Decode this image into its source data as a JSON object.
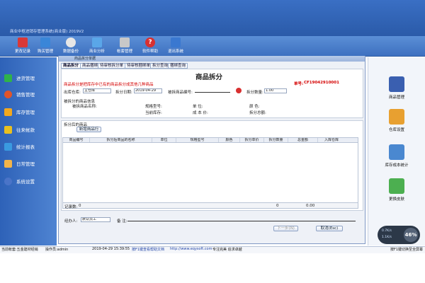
{
  "titlebar": {
    "title": "商业中枢进销存管理系统(商业版) 2019V2"
  },
  "toolbar": [
    {
      "label": "更改记录",
      "color": "#ffffff"
    },
    {
      "label": "购买管理",
      "color": "#ffffff"
    },
    {
      "label": "数据备份",
      "color": "#ffffff"
    },
    {
      "label": "商业分析",
      "color": "#ffffff"
    },
    {
      "label": "帐套管理",
      "color": "#ffffff"
    },
    {
      "label": "软件帮助",
      "color": "#ffffff"
    },
    {
      "label": "退出系统",
      "color": "#ffffff"
    }
  ],
  "nav": [
    {
      "label": "进货管理",
      "icon": "plus-icon",
      "color": "#2fb24a"
    },
    {
      "label": "销售管理",
      "icon": "pie-icon",
      "color": "#e0542a"
    },
    {
      "label": "库存管理",
      "icon": "star-icon",
      "color": "#f2a81e"
    },
    {
      "label": "往来帐款",
      "icon": "dollar-icon",
      "color": "#e8c020"
    },
    {
      "label": "统计报表",
      "icon": "chart-icon",
      "color": "#3a9ae0"
    },
    {
      "label": "日常管理",
      "icon": "folder-icon",
      "color": "#f2b44a"
    },
    {
      "label": "系统设置",
      "icon": "gear-icon",
      "color": "#4a74c8"
    }
  ],
  "right_panel": [
    {
      "label": "商品管理",
      "icon": "book-icon",
      "color": "#3a5fb0"
    },
    {
      "label": "仓库设置",
      "icon": "house-icon",
      "color": "#e8a030"
    },
    {
      "label": "库存成本统计",
      "icon": "stats-icon",
      "color": "#4a88d0"
    },
    {
      "label": "更换皮肤",
      "icon": "cube-icon",
      "color": "#4caf50"
    }
  ],
  "window": {
    "title": "商品拆分单据",
    "tabs": [
      "商品拆分",
      "商品捆绑",
      "待审核拆分单",
      "待审核捆绑单",
      "拆分查询",
      "捆绑查询"
    ],
    "heading": "商品拆分",
    "subtitle": "商品拆分是把库存中已有的商品拆分成其他几种商品",
    "doc_no_label": "单号:",
    "doc_no": "CF19042910001",
    "out_warehouse_label": "出库仓库:",
    "out_warehouse": "主仓库",
    "date_label": "拆分日期:",
    "date": "2019-04-29",
    "item_code_label": "被拆商品编号:",
    "qty_label": "拆分数量:",
    "qty": "1.00",
    "source_section": "被拆分的商品信息",
    "source_name_label": "被拆商品名称:",
    "spec_label": "规格型号:",
    "stock_label": "当前库存:",
    "unit_label": "单   位:",
    "cost_label": "成 本 价:",
    "color_label": "颜    色:",
    "total_label": "拆分总额:",
    "result_section": "拆分后的商品",
    "add_button": "新增商品行",
    "grid_columns": [
      "商品编号",
      "拆分后商品的名称",
      "单位",
      "规格型号",
      "颜色",
      "拆分单价",
      "拆分数量",
      "总金额",
      "入库仓库"
    ],
    "record_count_label": "记录数:",
    "record_count": "0",
    "sum_qty": "0",
    "sum_amount": "0.00",
    "handler_label": "经办人:",
    "handler": "默认员工",
    "remark_label": "备 注:",
    "next_button": "下一步(N)",
    "cancel_button": "取消(Esc)"
  },
  "statusbar": {
    "company": "当前帐套:五金建材经销",
    "operator": "操作员:admin",
    "datetime": "2019-04-29 15:39:55",
    "help_link": "按F1键查看帮助文档",
    "website": "http://www.eqysoft.com",
    "slogan": "专注完美 追求卓越",
    "hint": "按F1键切换至全屏幕"
  },
  "widget": {
    "up": "0.7K/s",
    "down": "1.1K/s",
    "percent": "46%"
  }
}
